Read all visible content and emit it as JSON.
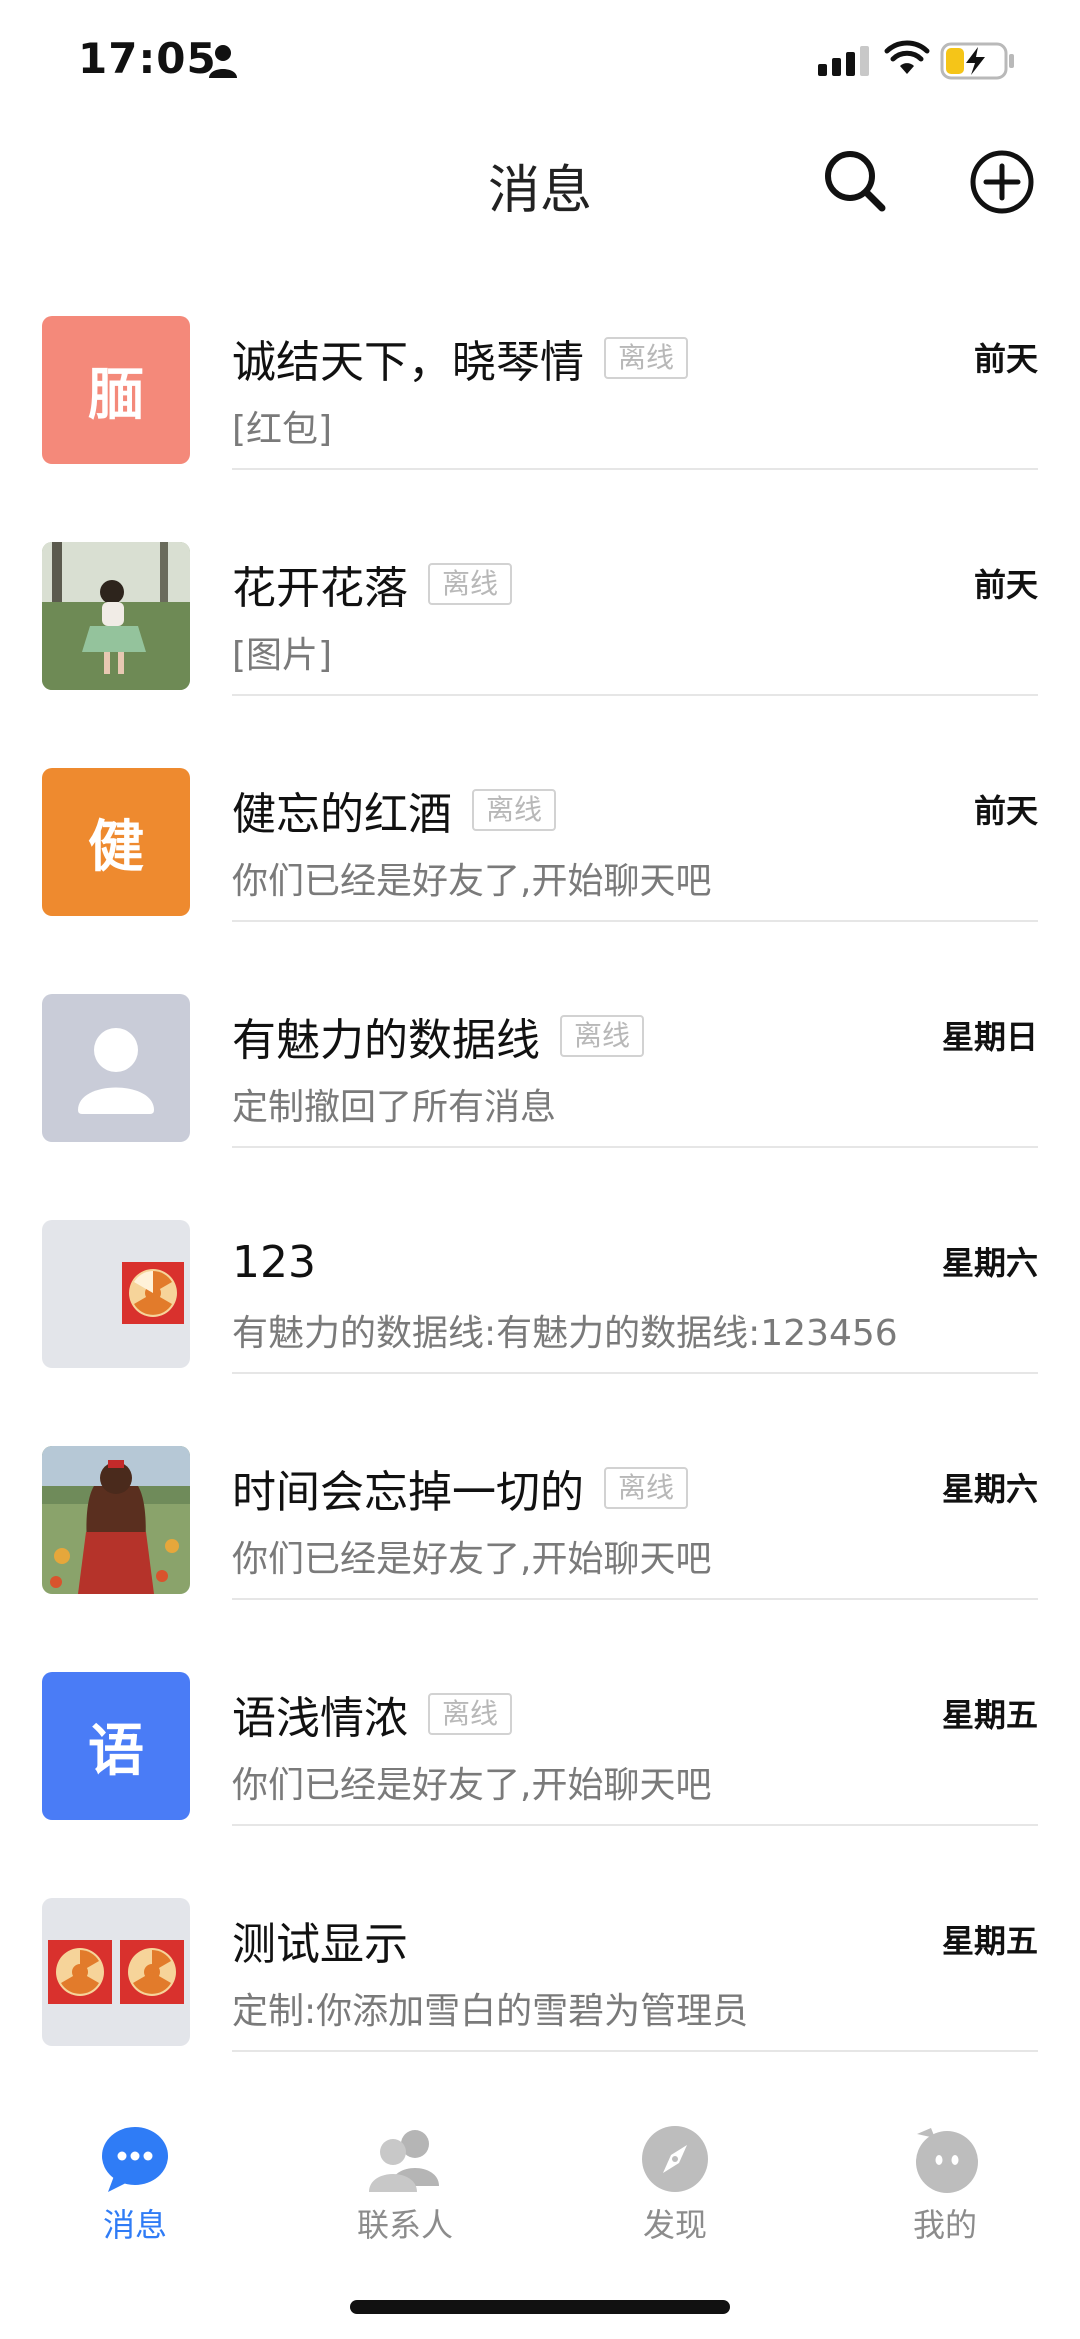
{
  "status_bar": {
    "time": "17:05",
    "icons": [
      "person-icon",
      "signal-icon",
      "wifi-icon",
      "battery-charging-icon"
    ]
  },
  "header": {
    "title": "消息",
    "icons": [
      "search-icon",
      "add-circle-icon"
    ]
  },
  "conversations": [
    {
      "avatar_text": "腼",
      "avatar_color": "#f4897a",
      "name": "诚结天下，晓琴情",
      "offline": "离线",
      "time": "前天",
      "preview": "[红包]"
    },
    {
      "avatar_text": "",
      "avatar_kind": "photo-girl-on-grass",
      "name": "花开花落",
      "offline": "离线",
      "time": "前天",
      "preview": "[图片]"
    },
    {
      "avatar_text": "健",
      "avatar_color": "#ee8a2f",
      "name": "健忘的红酒",
      "offline": "离线",
      "time": "前天",
      "preview": "你们已经是好友了,开始聊天吧"
    },
    {
      "avatar_text": "",
      "avatar_kind": "default-person",
      "avatar_color": "#c9ccd8",
      "name": "有魅力的数据线",
      "offline": "离线",
      "time": "星期日",
      "preview": "定制撤回了所有消息"
    },
    {
      "avatar_text": "",
      "avatar_kind": "group-one-tile",
      "avatar_color": "#e3e5ea",
      "name": "123",
      "offline": "",
      "time": "星期六",
      "preview": "有魅力的数据线:有魅力的数据线:123456"
    },
    {
      "avatar_text": "",
      "avatar_kind": "photo-girl-in-field",
      "name": "时间会忘掉一切的",
      "offline": "离线",
      "time": "星期六",
      "preview": "你们已经是好友了,开始聊天吧"
    },
    {
      "avatar_text": "语",
      "avatar_color": "#4a7cf6",
      "name": "语浅情浓",
      "offline": "离线",
      "time": "星期五",
      "preview": "你们已经是好友了,开始聊天吧"
    },
    {
      "avatar_text": "",
      "avatar_kind": "group-two-tiles",
      "avatar_color": "#e3e5ea",
      "name": "测试显示",
      "offline": "",
      "time": "星期五",
      "preview": "定制:你添加雪白的雪碧为管理员"
    }
  ],
  "tabs": [
    {
      "label": "消息",
      "icon": "chat-bubble-icon",
      "active": true
    },
    {
      "label": "联系人",
      "icon": "contacts-icon",
      "active": false
    },
    {
      "label": "发现",
      "icon": "compass-icon",
      "active": false
    },
    {
      "label": "我的",
      "icon": "profile-icon",
      "active": false
    }
  ],
  "colors": {
    "accent": "#2f7cf6",
    "inactive_tab": "#8c8c8c",
    "offline_badge": "#b8b8b8"
  }
}
